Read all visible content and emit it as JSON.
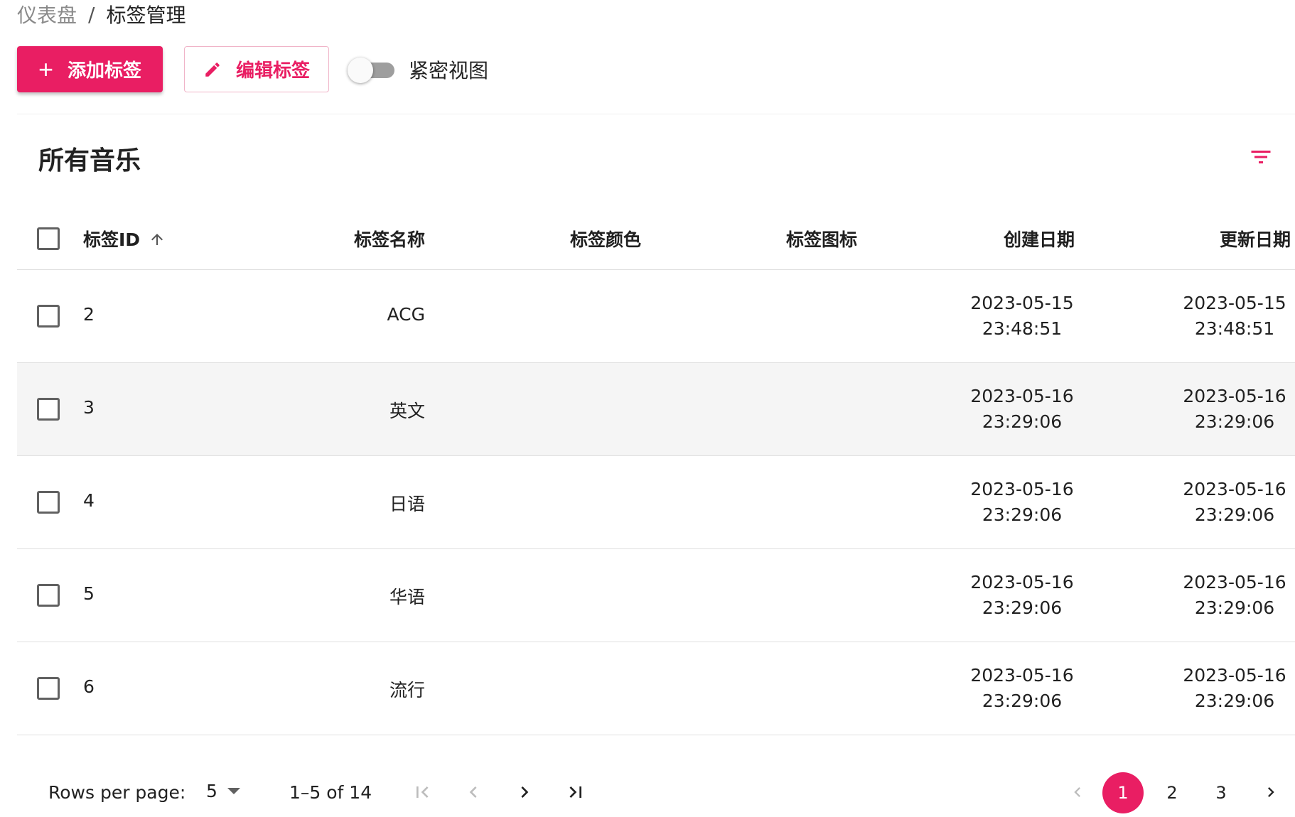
{
  "breadcrumb": {
    "root": "仪表盘",
    "separator": "/",
    "current": "标签管理"
  },
  "toolbar": {
    "add_label": "添加标签",
    "add_icon": "plus-icon",
    "edit_label": "编辑标签",
    "edit_icon": "pencil-icon",
    "dense_toggle_label": "紧密视图",
    "dense_toggle_on": false
  },
  "card": {
    "title": "所有音乐",
    "filter_icon": "filter-list-icon"
  },
  "table": {
    "columns": [
      "标签ID",
      "标签名称",
      "标签颜色",
      "标签图标",
      "创建日期",
      "更新日期"
    ],
    "sort": {
      "column": "标签ID",
      "direction": "asc"
    },
    "rows": [
      {
        "id": "2",
        "name": "ACG",
        "color": "",
        "icon": "",
        "created_date": "2023-05-15",
        "created_time": "23:48:51",
        "updated_date": "2023-05-15",
        "updated_time": "23:48:51"
      },
      {
        "id": "3",
        "name": "英文",
        "color": "",
        "icon": "",
        "created_date": "2023-05-16",
        "created_time": "23:29:06",
        "updated_date": "2023-05-16",
        "updated_time": "23:29:06"
      },
      {
        "id": "4",
        "name": "日语",
        "color": "",
        "icon": "",
        "created_date": "2023-05-16",
        "created_time": "23:29:06",
        "updated_date": "2023-05-16",
        "updated_time": "23:29:06"
      },
      {
        "id": "5",
        "name": "华语",
        "color": "",
        "icon": "",
        "created_date": "2023-05-16",
        "created_time": "23:29:06",
        "updated_date": "2023-05-16",
        "updated_time": "23:29:06"
      },
      {
        "id": "6",
        "name": "流行",
        "color": "",
        "icon": "",
        "created_date": "2023-05-16",
        "created_time": "23:29:06",
        "updated_date": "2023-05-16",
        "updated_time": "23:29:06"
      }
    ]
  },
  "pagination": {
    "rows_per_page_label": "Rows per page:",
    "rows_per_page": "5",
    "range": "1–5 of 14",
    "pages": [
      "1",
      "2",
      "3"
    ],
    "current_page": "1"
  },
  "colors": {
    "accent": "#e91e63",
    "hover_row": "#f5f5f5",
    "divider": "#e0e0e0"
  }
}
